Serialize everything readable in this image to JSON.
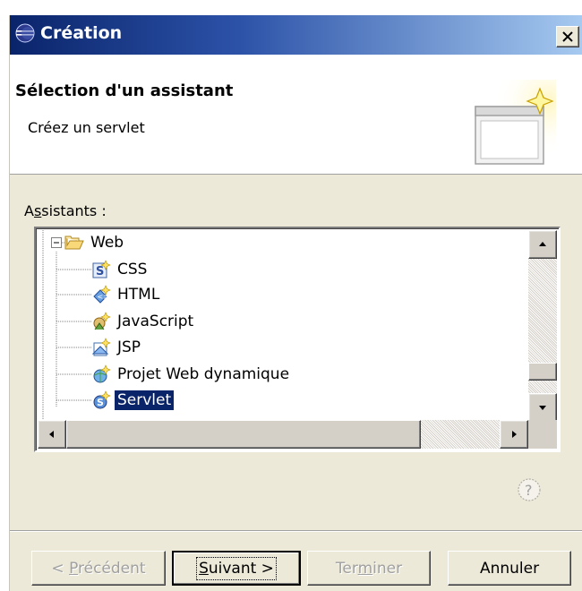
{
  "window": {
    "title": "Création",
    "close_glyph": "×"
  },
  "header": {
    "title": "Sélection d'un assistant",
    "subtitle": "Créez un servlet"
  },
  "assistants": {
    "label_prefix": "A",
    "label_mnemonic": "s",
    "label_rest": "sistants :"
  },
  "tree": {
    "root": {
      "label": "Web",
      "icon": "folder-open-icon",
      "expanded": true
    },
    "items": [
      {
        "label": "CSS",
        "icon": "css-wizard-icon"
      },
      {
        "label": "HTML",
        "icon": "html-wizard-icon"
      },
      {
        "label": "JavaScript",
        "icon": "javascript-wizard-icon"
      },
      {
        "label": "JSP",
        "icon": "jsp-wizard-icon"
      },
      {
        "label": "Projet Web dynamique",
        "icon": "web-project-wizard-icon"
      },
      {
        "label": "Servlet",
        "icon": "servlet-wizard-icon",
        "selected": true
      }
    ]
  },
  "buttons": {
    "back": {
      "prefix": "< ",
      "mnemonic": "P",
      "rest": "récédent",
      "enabled": false
    },
    "next": {
      "mnemonic": "S",
      "rest": "uivant >",
      "enabled": true
    },
    "finish": {
      "prefix": "Ter",
      "mnemonic": "m",
      "rest": "iner",
      "enabled": false
    },
    "cancel": {
      "label": "Annuler",
      "enabled": true
    }
  },
  "colors": {
    "titlebar_start": "#0a246a",
    "titlebar_end": "#a6caf0",
    "selection": "#0a246a",
    "dialog_bg": "#ece9d8"
  }
}
